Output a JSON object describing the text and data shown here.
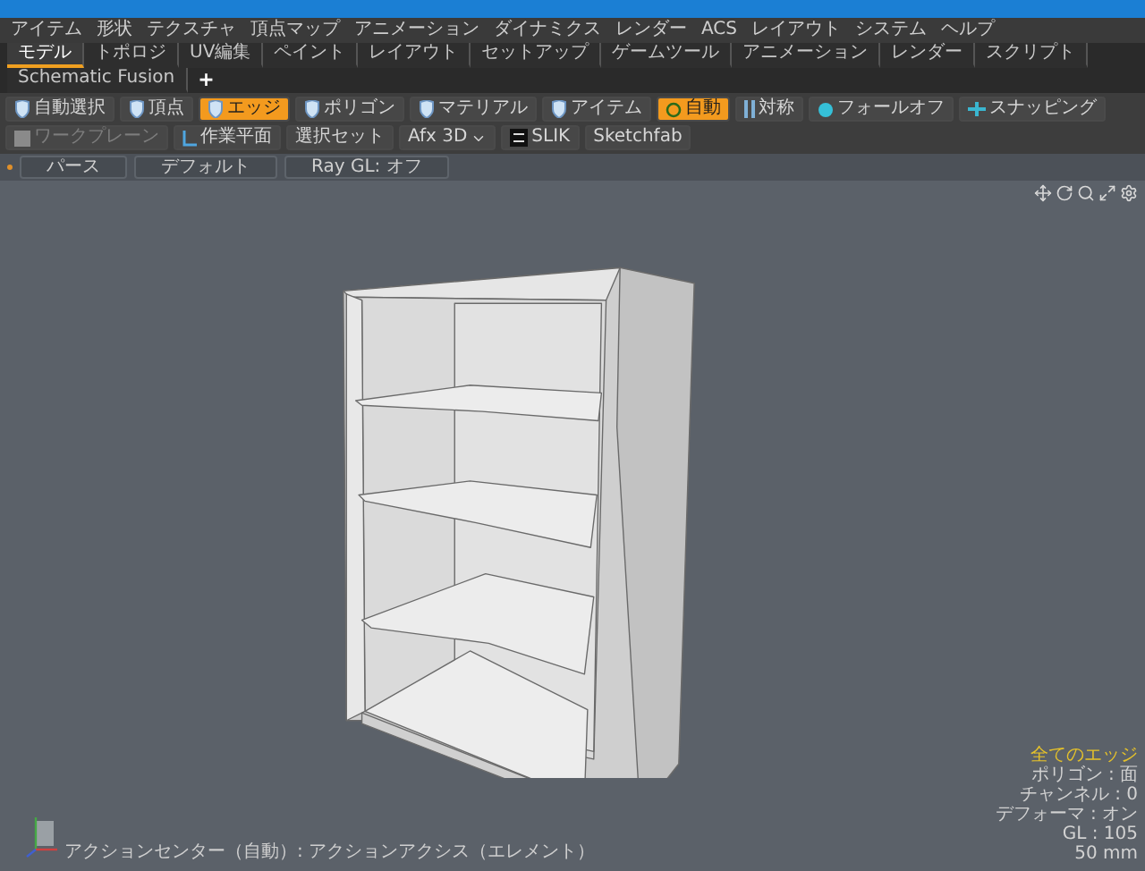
{
  "menu": [
    "アイテム",
    "形状",
    "テクスチャ",
    "頂点マップ",
    "アニメーション",
    "ダイナミクス",
    "レンダー",
    "ACS",
    "レイアウト",
    "システム",
    "ヘルプ"
  ],
  "mode_tabs": [
    {
      "label": "モデル",
      "selected": true
    },
    {
      "label": "トポロジ",
      "selected": false
    },
    {
      "label": "UV編集",
      "selected": false
    },
    {
      "label": "ペイント",
      "selected": false
    },
    {
      "label": "レイアウト",
      "selected": false
    },
    {
      "label": "セットアップ",
      "selected": false
    },
    {
      "label": "ゲームツール",
      "selected": false
    },
    {
      "label": "アニメーション",
      "selected": false
    },
    {
      "label": "レンダー",
      "selected": false
    },
    {
      "label": "スクリプト",
      "selected": false
    },
    {
      "label": "Schematic Fusion",
      "selected": false
    }
  ],
  "add_tab": "+",
  "toolbar": [
    {
      "label": "自動選択",
      "kind": "tool",
      "selected": false,
      "disabled": false
    },
    {
      "label": "頂点",
      "kind": "tool",
      "selected": false,
      "disabled": false
    },
    {
      "label": "エッジ",
      "kind": "tool",
      "selected": true,
      "disabled": false
    },
    {
      "label": "ポリゴン",
      "kind": "tool",
      "selected": false,
      "disabled": false
    },
    {
      "label": "マテリアル",
      "kind": "tool",
      "selected": false,
      "disabled": false
    },
    {
      "label": "アイテム",
      "kind": "tool",
      "selected": false,
      "disabled": false
    },
    {
      "label": "自動",
      "kind": "tool",
      "selected": true,
      "disabled": false
    },
    {
      "label": "対称",
      "kind": "tool",
      "selected": false,
      "disabled": false
    },
    {
      "label": "フォールオフ",
      "kind": "tool",
      "selected": false,
      "disabled": false
    },
    {
      "label": "スナッピング",
      "kind": "tool",
      "selected": false,
      "disabled": false
    },
    {
      "label": "ワークプレーン",
      "kind": "tool",
      "selected": false,
      "disabled": true
    },
    {
      "label": "作業平面",
      "kind": "tool",
      "selected": false,
      "disabled": false
    },
    {
      "label": "選択セット",
      "kind": "plain",
      "selected": false,
      "disabled": false
    },
    {
      "label": "Afx 3D",
      "kind": "dropdown",
      "selected": false,
      "disabled": false
    },
    {
      "label": "SLIK",
      "kind": "tool",
      "selected": false,
      "disabled": false
    },
    {
      "label": "Sketchfab",
      "kind": "plain",
      "selected": false,
      "disabled": false
    }
  ],
  "viewport_options": [
    "パース",
    "デフォルト",
    "Ray GL: オフ"
  ],
  "info": {
    "title": "全てのエッジ",
    "lines": [
      "ポリゴン : 面",
      "チャンネル : 0",
      "デフォーマ : オン",
      "GL : 105",
      "50 mm"
    ]
  },
  "status": "アクションセンター（自動）: アクションアクシス（エレメント）"
}
